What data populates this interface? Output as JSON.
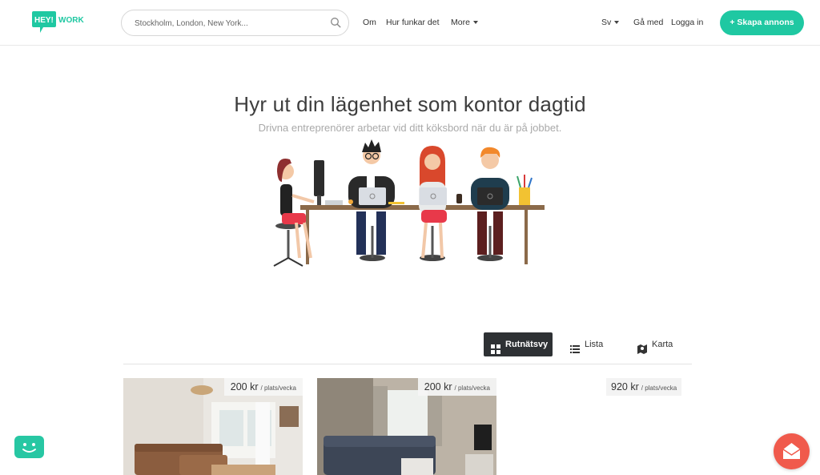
{
  "brand": {
    "logo_text": "HEY! WORK",
    "accent": "#1fc8a2"
  },
  "search": {
    "placeholder": "Stockholm, London, New York..."
  },
  "nav": {
    "om": "Om",
    "how": "Hur funkar det",
    "more": "More",
    "lang": "Sv",
    "join": "Gå med",
    "login": "Logga in",
    "create_listing": "+ Skapa annons"
  },
  "hero": {
    "title": "Hyr ut din lägenhet som kontor dagtid",
    "subtitle": "Drivna entreprenörer arbetar vid ditt köksbord när du är på jobbet."
  },
  "views": [
    {
      "label": "Rutnätsvy",
      "icon": "grid-icon",
      "active": true
    },
    {
      "label": "Lista",
      "icon": "list-icon",
      "active": false
    },
    {
      "label": "Karta",
      "icon": "map-icon",
      "active": false
    }
  ],
  "listings": [
    {
      "price": "200 kr",
      "per": "/ plats/vecka"
    },
    {
      "price": "200 kr",
      "per": "/ plats/vecka"
    },
    {
      "price": "920 kr",
      "per": "/ plats/vecka"
    }
  ],
  "widgets": {
    "chat_icon": "chat-bot-icon",
    "mail_icon": "mail-icon",
    "chat_color": "#27c7a3",
    "mail_color": "#f05a4c"
  }
}
